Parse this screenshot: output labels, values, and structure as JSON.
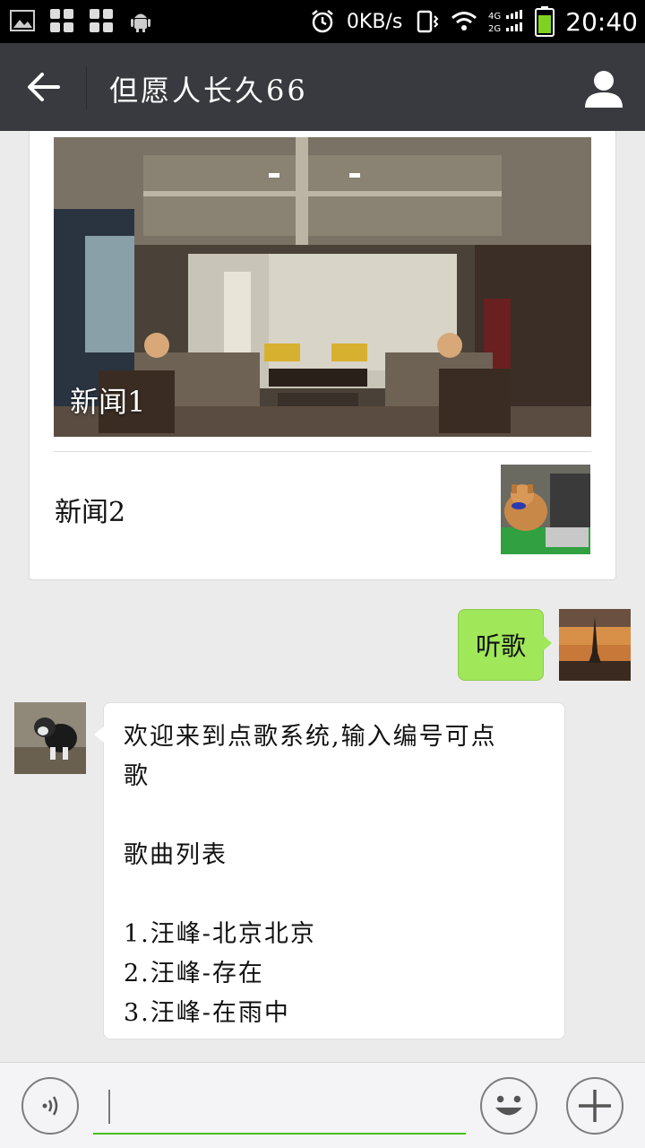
{
  "status_bar": {
    "network_speed": "0KB/s",
    "network_types": [
      "4G",
      "2G"
    ],
    "time": "20:40",
    "icons": [
      "gallery-icon",
      "apps-icon",
      "apps-icon",
      "android-icon",
      "alarm-icon",
      "vibrate-icon",
      "wifi-icon",
      "signal-icon",
      "battery-icon"
    ]
  },
  "header": {
    "title": "但愿人长久66",
    "back_icon": "back-arrow-icon",
    "profile_icon": "person-icon"
  },
  "news_card": {
    "items": [
      {
        "title": "新闻1"
      },
      {
        "title": "新闻2"
      }
    ]
  },
  "messages": [
    {
      "direction": "outgoing",
      "text": "听歌"
    },
    {
      "direction": "incoming",
      "lines": [
        "欢迎来到点歌系统,输入编号可点",
        "歌",
        "",
        "歌曲列表",
        "",
        "1.汪峰-北京北京",
        "2.汪峰-存在",
        "3.汪峰-在雨中"
      ]
    }
  ],
  "input_bar": {
    "value": "",
    "icons": [
      "voice-icon",
      "emoji-icon",
      "plus-icon"
    ]
  },
  "colors": {
    "titlebar": "#393a3f",
    "outgoing_bubble": "#a0e75a",
    "input_underline": "#45c01a",
    "background": "#ebebeb"
  }
}
